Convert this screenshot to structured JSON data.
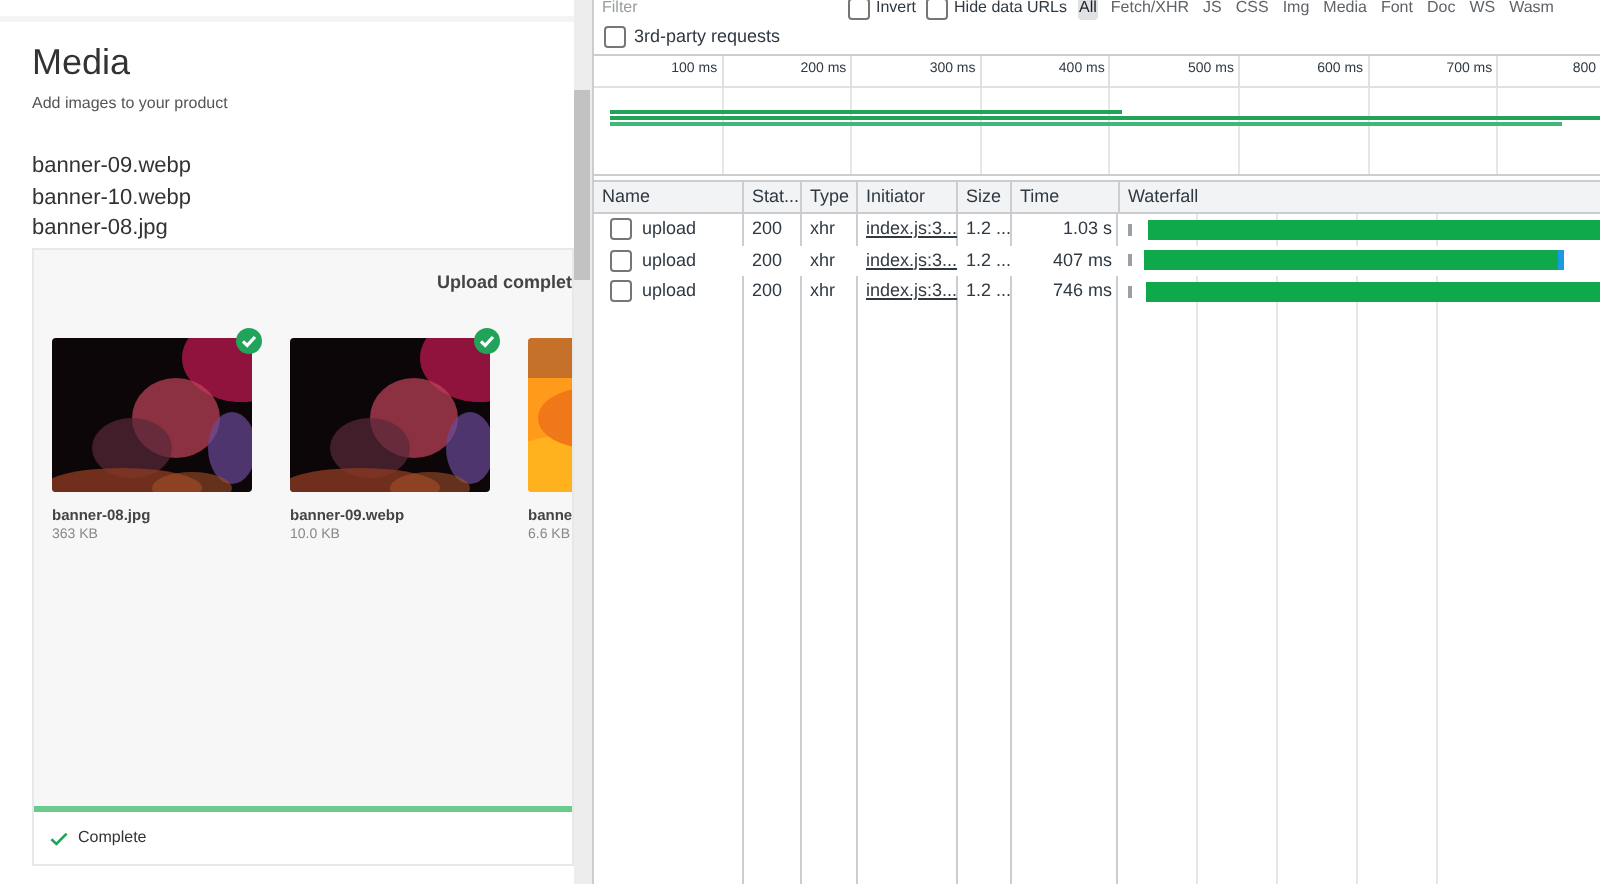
{
  "media": {
    "title": "Media",
    "subtitle": "Add images to your product",
    "files": [
      "banner-09.webp",
      "banner-10.webp",
      "banner-08.jpg"
    ],
    "upload": {
      "status_text": "Upload complet",
      "items": [
        {
          "name": "banner-08.jpg",
          "size": "363 KB",
          "uploaded": true
        },
        {
          "name": "banner-09.webp",
          "size": "10.0 KB",
          "uploaded": true
        },
        {
          "name": "banne",
          "size": "6.6 KB",
          "uploaded": false
        }
      ],
      "footer": "Complete"
    }
  },
  "devtools": {
    "filter": {
      "placeholder": "Filter"
    },
    "options": [
      {
        "label": "Invert",
        "checked": false
      },
      {
        "label": "Hide data URLs",
        "checked": false
      }
    ],
    "types": [
      {
        "label": "All",
        "selected": true
      },
      {
        "label": "Fetch/XHR",
        "selected": false
      },
      {
        "label": "JS",
        "selected": false
      },
      {
        "label": "CSS",
        "selected": false
      },
      {
        "label": "Img",
        "selected": false
      },
      {
        "label": "Media",
        "selected": false
      },
      {
        "label": "Font",
        "selected": false
      },
      {
        "label": "Doc",
        "selected": false
      },
      {
        "label": "WS",
        "selected": false
      },
      {
        "label": "Wasm",
        "selected": false
      }
    ],
    "third_party": {
      "label": "3rd-party requests",
      "checked": false
    },
    "overview_ticks": [
      "100 ms",
      "200 ms",
      "300 ms",
      "400 ms",
      "500 ms",
      "600 ms",
      "700 ms",
      "800"
    ],
    "table": {
      "columns": [
        "Name",
        "Stat...",
        "Type",
        "Initiator",
        "Size",
        "Time",
        "Waterfall"
      ],
      "rows": [
        {
          "checked": false,
          "name": "upload",
          "status": "200",
          "type": "xhr",
          "initiator": "index.js:3...",
          "size": "1.2 ...",
          "time": "1.03 s"
        },
        {
          "checked": false,
          "name": "upload",
          "status": "200",
          "type": "xhr",
          "initiator": "index.js:3...",
          "size": "1.2 ...",
          "time": "407 ms"
        },
        {
          "checked": false,
          "name": "upload",
          "status": "200",
          "type": "xhr",
          "initiator": "index.js:3...",
          "size": "1.2 ...",
          "time": "746 ms"
        }
      ]
    }
  }
}
